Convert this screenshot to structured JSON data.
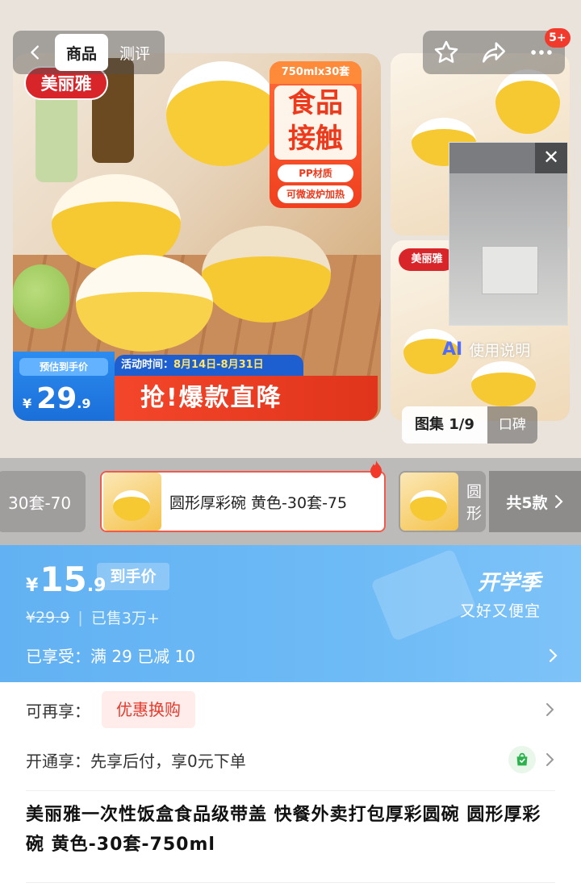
{
  "header": {
    "tabs": [
      {
        "label": "商品",
        "active": true
      },
      {
        "label": "测评",
        "active": false
      }
    ],
    "cart_badge": "5+"
  },
  "gallery": {
    "brand_badge": "美丽雅",
    "side_brand": "美丽雅",
    "promo": {
      "spec": "750mlx30套",
      "headline_line1": "食品",
      "headline_line2": "接触",
      "pill1": "PP材质",
      "pill2": "可微波炉加热"
    },
    "ribbon": {
      "label": "预估到手价",
      "currency": "¥",
      "price_int": "29",
      "price_dec": ".9",
      "activity_prefix": "活动时间：",
      "activity_dates": "8月14日-8月31日",
      "slogan": "抢!爆款直降"
    },
    "ai_label": "AI",
    "guide_label": "使用说明",
    "pager_current": "图集 1/9",
    "pager_other": "口碑"
  },
  "sku": {
    "prev_label": "30套-70",
    "selected_label": "圆形厚彩碗 黄色-30套-75",
    "next_label": "圆形",
    "total_label": "共5款"
  },
  "price": {
    "currency": "¥",
    "int": "15",
    "dec": ".9",
    "tag": "到手价",
    "original": "¥29.9",
    "divider": "|",
    "sold": "已售3万+",
    "season_title": "开学季",
    "season_sub": "又好又便宜",
    "enjoyed": "已享受：满 29 已减 10"
  },
  "benefits": {
    "more_label": "可再享：",
    "coupon_label": "优惠换购",
    "pay_label": "开通享：先享后付，享0元下单"
  },
  "product": {
    "title": "美丽雅一次性饭盒食品级带盖 快餐外卖打包厚彩圆碗 圆形厚彩碗 黄色-30套-750ml"
  }
}
